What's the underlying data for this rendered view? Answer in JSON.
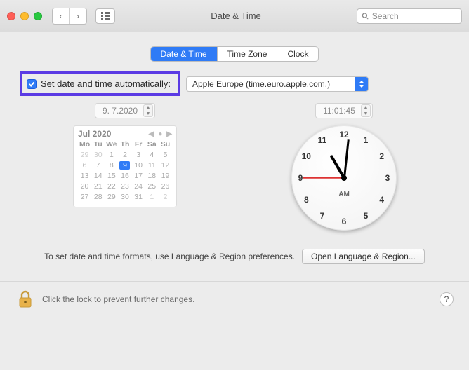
{
  "titlebar": {
    "title": "Date & Time",
    "search_placeholder": "Search"
  },
  "tabs": {
    "date_time": "Date & Time",
    "time_zone": "Time Zone",
    "clock": "Clock"
  },
  "auto": {
    "label": "Set date and time automatically:",
    "server": "Apple Europe (time.euro.apple.com.)",
    "checked": true
  },
  "date_field": "9.  7.2020",
  "time_field": "11:01:45",
  "calendar": {
    "title": "Jul 2020",
    "dow": [
      "Mo",
      "Tu",
      "We",
      "Th",
      "Fr",
      "Sa",
      "Su"
    ],
    "lead_dim": [
      "29",
      "30"
    ],
    "days": [
      "1",
      "2",
      "3",
      "4",
      "5",
      "6",
      "7",
      "8",
      "9",
      "10",
      "11",
      "12",
      "13",
      "14",
      "15",
      "16",
      "17",
      "18",
      "19",
      "20",
      "21",
      "22",
      "23",
      "24",
      "25",
      "26",
      "27",
      "28",
      "29",
      "30",
      "31"
    ],
    "trail_dim": [
      "1",
      "2"
    ],
    "today": "9"
  },
  "clock": {
    "numbers": [
      "12",
      "1",
      "2",
      "3",
      "4",
      "5",
      "6",
      "7",
      "8",
      "9",
      "10",
      "11"
    ],
    "ampm": "AM"
  },
  "footer": {
    "hint": "To set date and time formats, use Language & Region preferences.",
    "button": "Open Language & Region..."
  },
  "lock": {
    "text": "Click the lock to prevent further changes."
  },
  "help": "?"
}
